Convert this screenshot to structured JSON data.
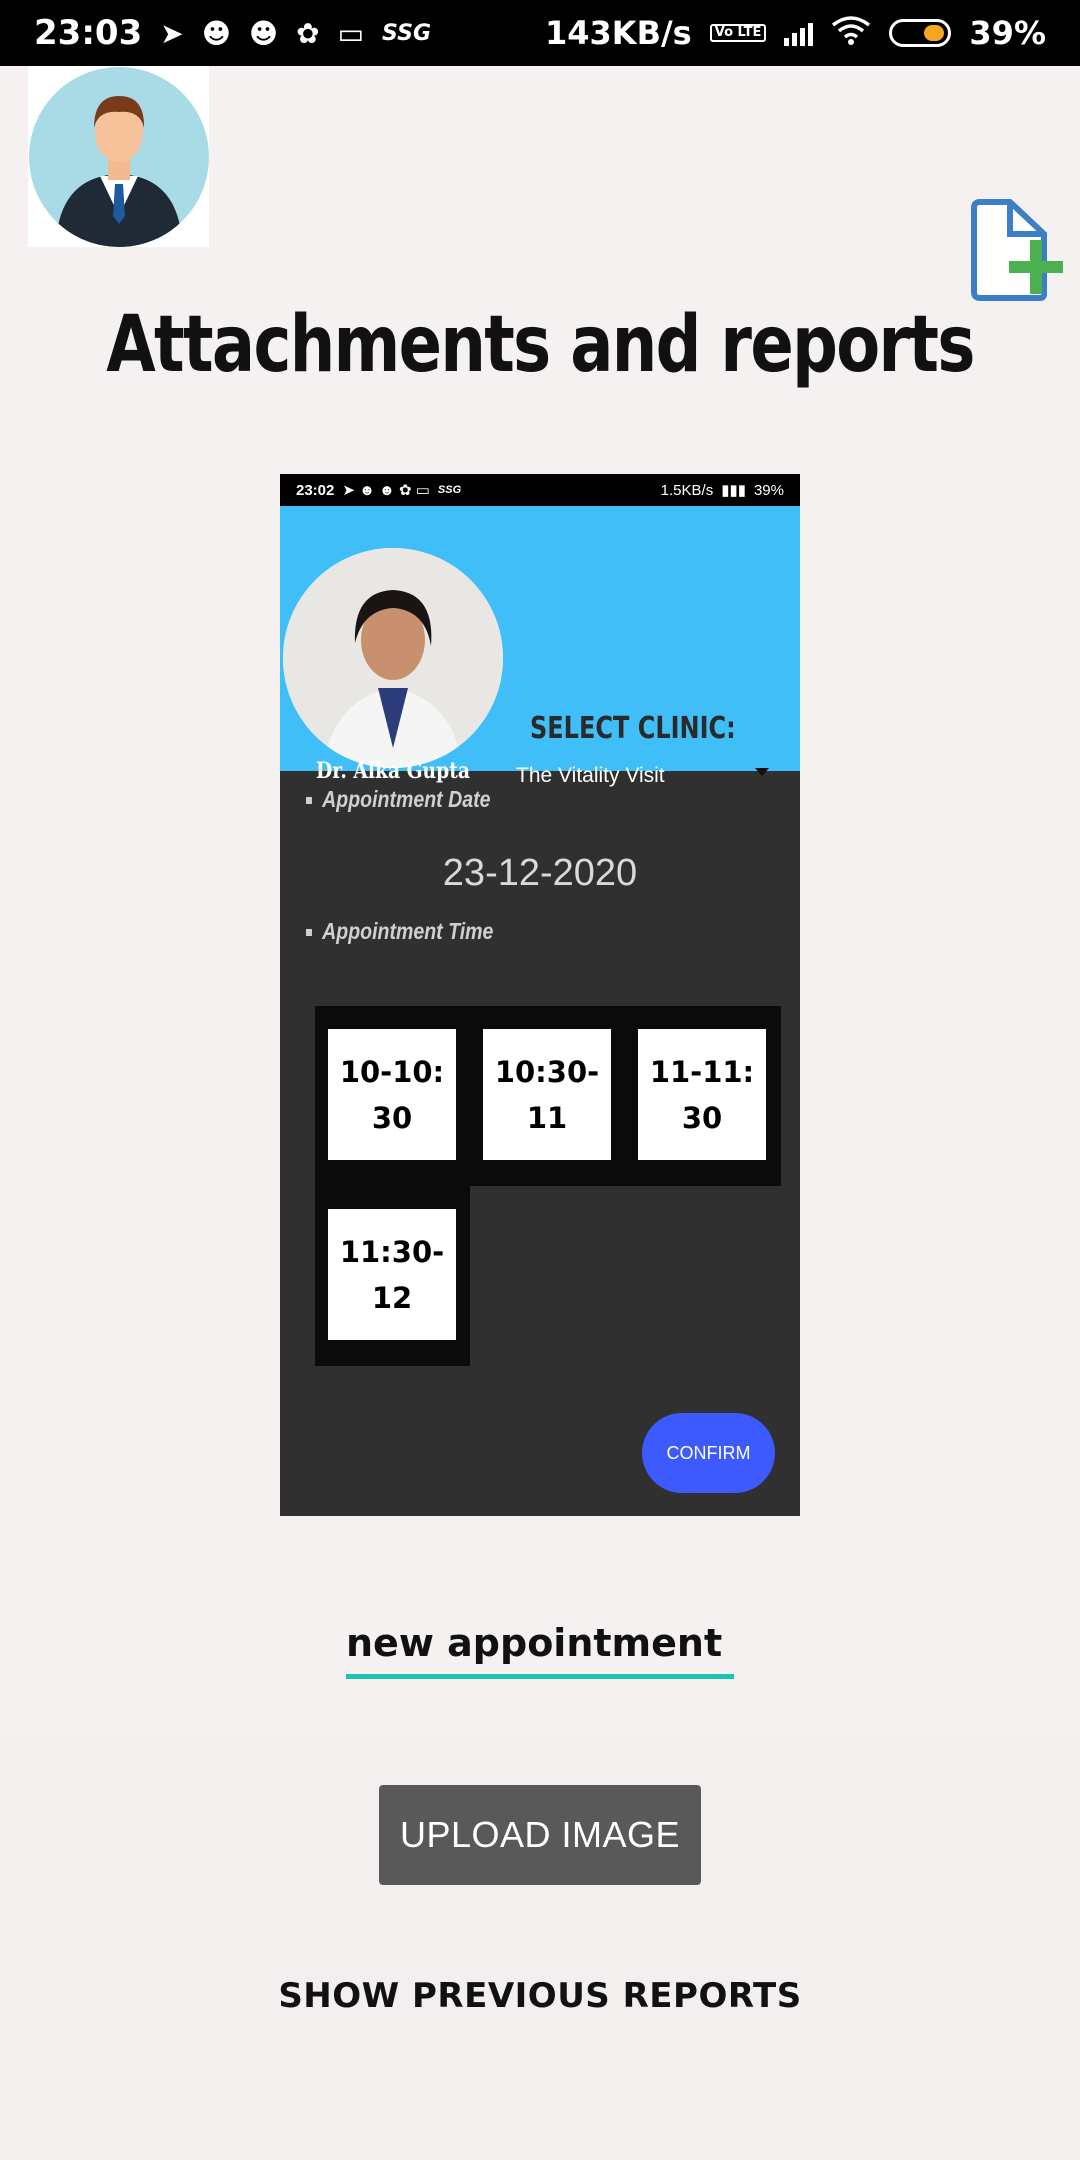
{
  "status_bar": {
    "time": "23:03",
    "ssg": "SSG",
    "speed": "143KB/s",
    "network_badge": "Vo LTE",
    "battery": "39%"
  },
  "header": {
    "title": "Attachments and reports"
  },
  "embedded_screenshot": {
    "status": {
      "time": "23:02",
      "ssg": "SSG",
      "speed": "1.5KB/s",
      "battery": "39%"
    },
    "doctor_name": "Dr. Alka Gupta",
    "select_clinic_label": "SELECT CLINIC:",
    "clinic_value": "The Vitality Visit",
    "appointment_date_label": "Appointment Date",
    "appointment_date_value": "23-12-2020",
    "appointment_time_label": "Appointment Time",
    "time_slots": [
      "10-10:30",
      "10:30-11",
      "11-11:30",
      "11:30-12"
    ],
    "confirm_label": "CONFIRM"
  },
  "form": {
    "name_value": "new appointment"
  },
  "actions": {
    "upload_label": "UPLOAD IMAGE",
    "show_previous_label": "SHOW PREVIOUS REPORTS"
  },
  "colors": {
    "accent_teal": "#19c4b4",
    "header_blue": "#3fbef8",
    "confirm_blue": "#3d5afe",
    "add_green": "#4caf50",
    "doc_icon_blue": "#3d7fc4"
  },
  "icons": [
    "telegram-icon",
    "snapchat-icon",
    "laptop-icon",
    "wifi-icon",
    "signal-icon",
    "battery-icon",
    "add-document-icon",
    "user-avatar-icon"
  ]
}
